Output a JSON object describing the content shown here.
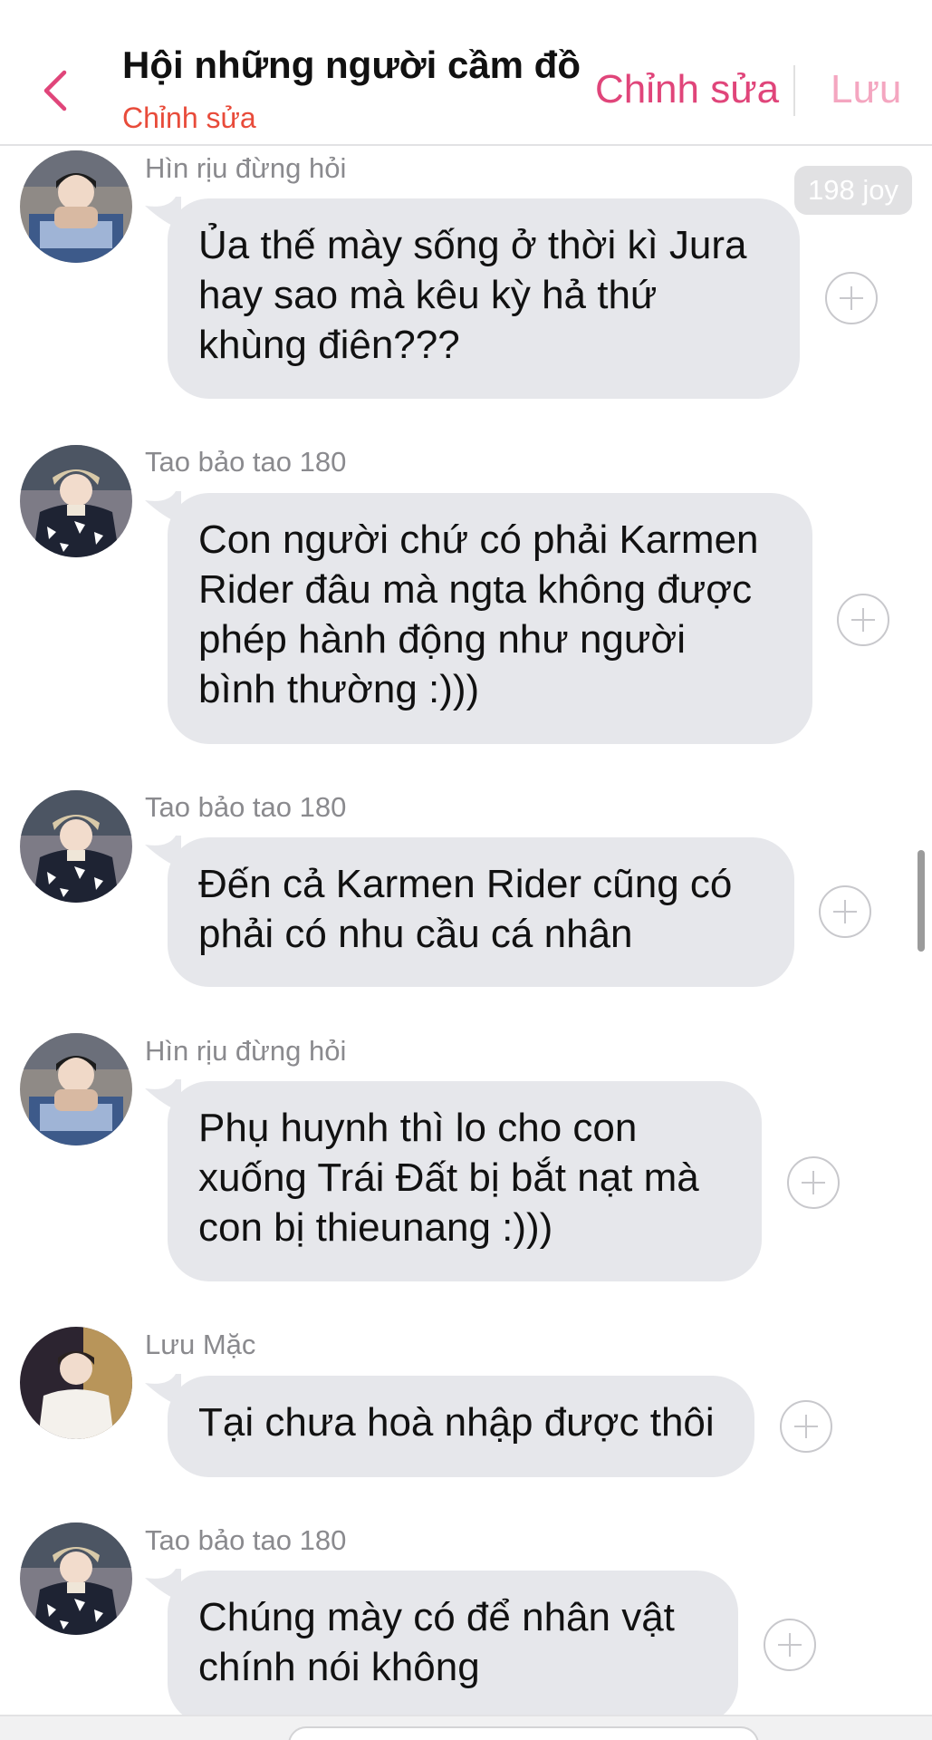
{
  "header": {
    "title": "Hội những người cầm đồ",
    "subtitle": "Chỉnh sửa",
    "edit_label": "Chỉnh sửa",
    "save_label": "Lưu",
    "accent_color": "#e0457a",
    "subtitle_color": "#e84b3a"
  },
  "joy_badge": "198 joy",
  "messages": [
    {
      "sender": "Hìn rịu đừng hỏi",
      "lines": [
        "Ủa thế mày sống ở thời kì Jura",
        "hay sao mà kêu kỳ hả thứ",
        "khùng điên???"
      ]
    },
    {
      "sender": "Tao bảo tao 180",
      "lines": [
        "Con người chứ có phải Karmen",
        "Rider đâu mà ngta không được",
        "phép hành động như người",
        "bình thường :)))"
      ]
    },
    {
      "sender": "Tao bảo tao 180",
      "lines": [
        "Đến cả Karmen Rider cũng có",
        "phải có nhu cầu cá nhân"
      ]
    },
    {
      "sender": "Hìn rịu đừng hỏi",
      "lines": [
        "Phụ huynh thì lo cho con",
        "xuống Trái Đất bị bắt nạt mà",
        "con bị thieunang :)))"
      ]
    },
    {
      "sender": "Lưu Mặc",
      "lines": [
        "Tại chưa hoà nhập được thôi"
      ]
    },
    {
      "sender": "Tao bảo tao 180",
      "lines": [
        "Chúng mày có để nhân vật",
        "chính nói không"
      ]
    }
  ]
}
